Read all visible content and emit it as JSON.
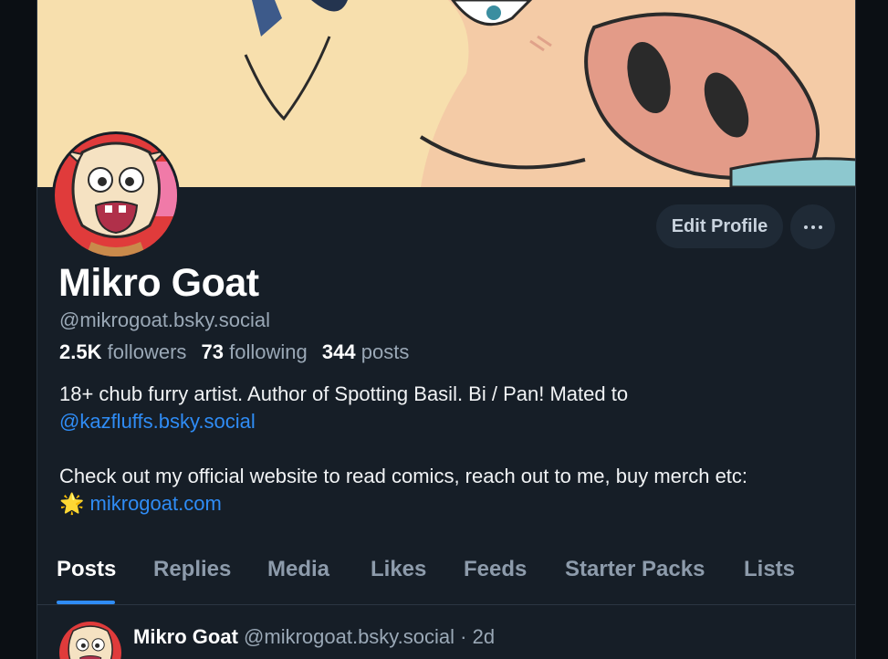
{
  "profile": {
    "display_name": "Mikro Goat",
    "handle": "@mikrogoat.bsky.social",
    "followers_count": "2.5K",
    "followers_label": "followers",
    "following_count": "73",
    "following_label": "following",
    "posts_count": "344",
    "posts_label": "posts"
  },
  "actions": {
    "edit_profile": "Edit Profile"
  },
  "bio": {
    "line1": "18+ chub furry artist. Author of Spotting Basil. Bi / Pan! Mated to",
    "mention": "@kazfluffs.bsky.social",
    "line3": "Check out my official website to read comics, reach out to me, buy merch etc:",
    "star": "🌟",
    "website": "mikrogoat.com"
  },
  "tabs": [
    {
      "label": "Posts",
      "active": true
    },
    {
      "label": "Replies"
    },
    {
      "label": "Media"
    },
    {
      "label": "Likes"
    },
    {
      "label": "Feeds"
    },
    {
      "label": "Starter Packs"
    },
    {
      "label": "Lists"
    }
  ],
  "post": {
    "author": "Mikro Goat",
    "handle": "@mikrogoat.bsky.social",
    "separator": "·",
    "time": "2d"
  },
  "colors": {
    "background": "#0b0f14",
    "panel": "#161e27",
    "accent": "#2f8cf5",
    "muted_text": "#9aa8b6"
  }
}
